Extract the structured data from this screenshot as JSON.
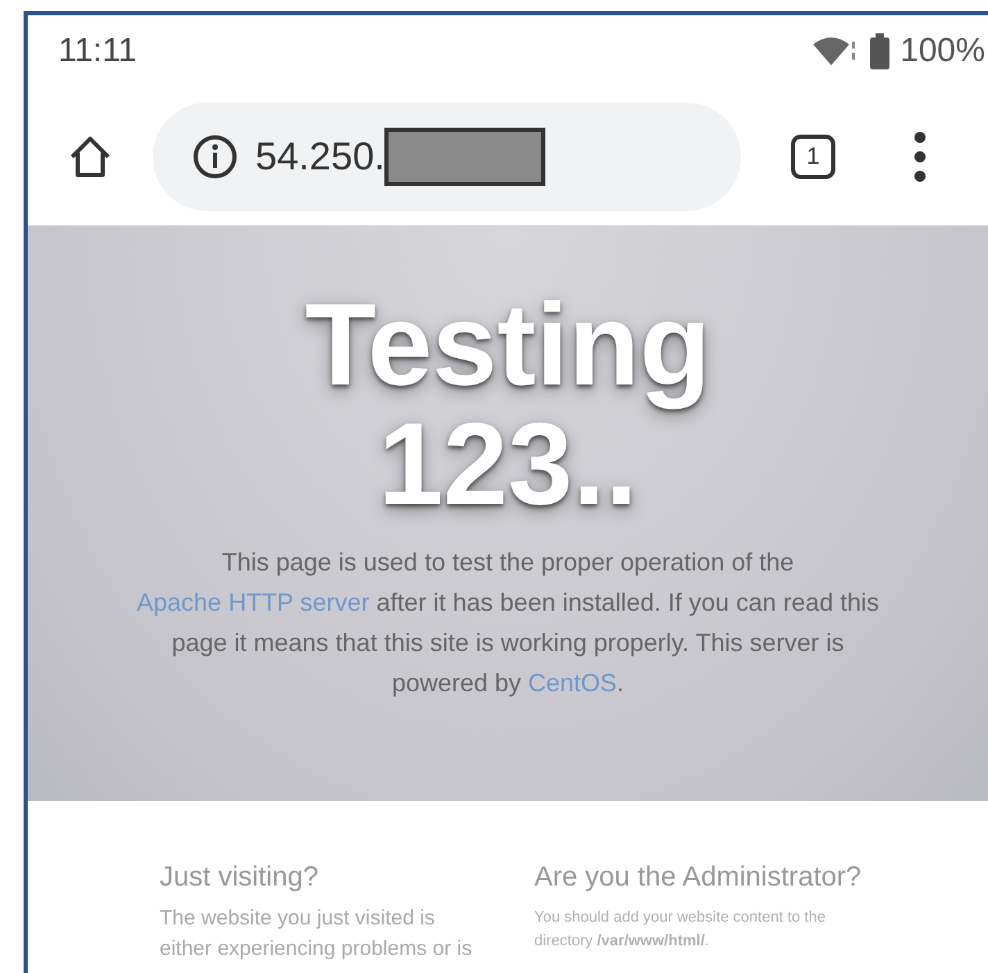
{
  "status_bar": {
    "time": "11:11",
    "battery": "100%"
  },
  "toolbar": {
    "url": "54.250.",
    "tab_count": "1"
  },
  "hero": {
    "title_lines": [
      "Testing",
      "123.."
    ],
    "paragraph": [
      {
        "kind": "text",
        "text": "This page is used to test the proper operation of the "
      },
      {
        "kind": "link",
        "text": "Apache HTTP server"
      },
      {
        "kind": "text",
        "text": " after it has been installed. If you can read this page it means that this site is working properly. This server is powered by "
      },
      {
        "kind": "link",
        "text": "CentOS"
      },
      {
        "kind": "text",
        "text": "."
      }
    ]
  },
  "sections": [
    {
      "heading": "Just visiting?",
      "text": "The website you just visited is either experiencing problems or is"
    },
    {
      "heading": "Are you the Administrator?",
      "text": "You should add your website content to the directory **/var/www/html/**."
    }
  ]
}
